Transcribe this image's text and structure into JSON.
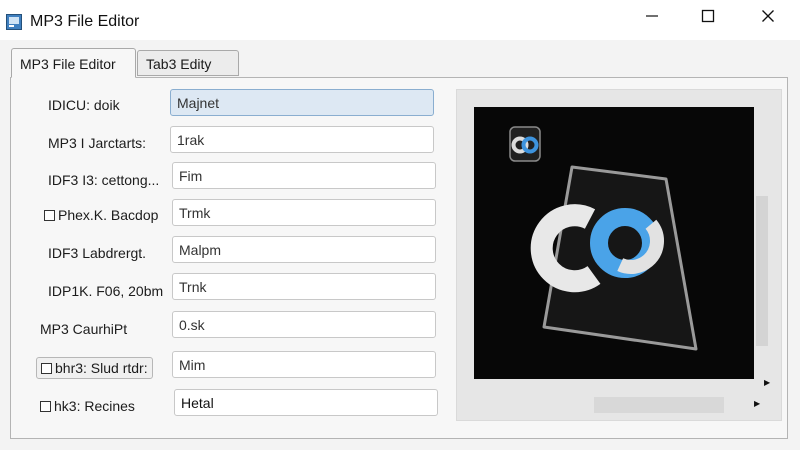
{
  "window": {
    "title": "MP3 File Editor",
    "icon": "app-icon",
    "buttons": [
      "minimize-icon",
      "maximize-icon",
      "close-icon"
    ]
  },
  "tabs": [
    {
      "label": "MP3 File Editor",
      "active": true
    },
    {
      "label": "Tab3 Edity",
      "active": false
    }
  ],
  "fields": [
    {
      "label": "IDICU: doik",
      "value": "Majnet",
      "focused": true
    },
    {
      "label": "MP3 I Jarctarts:",
      "value": "1rak"
    },
    {
      "label": "IDF3 I3: cettong...",
      "value": "Fim"
    },
    {
      "label": "Phex.K. Bacdop",
      "value": "Trmk",
      "icon": "checkbox-icon"
    },
    {
      "label": "IDF3 Labdrergt.",
      "value": "Malpm"
    },
    {
      "label": "IDP1K. F06, 20bm",
      "value": "Trnk"
    },
    {
      "label": "MP3 CaurhiPt",
      "value": "0.sk"
    },
    {
      "label": "bhr3: Slud rtdr:",
      "value": "Mim",
      "icon": "checkbox-icon",
      "boxed": true
    },
    {
      "label": "hk3: Recines",
      "value": "Hetal",
      "icon": "checkbox-icon"
    }
  ],
  "album_art": {
    "description_icon": "cd-logo-icon",
    "accent": "#4aa3e8"
  },
  "colors": {
    "titlebar": "#ffffff",
    "panel": "#f7f7f7",
    "focus_field": "#dde8f3",
    "art_background": "#070707"
  }
}
